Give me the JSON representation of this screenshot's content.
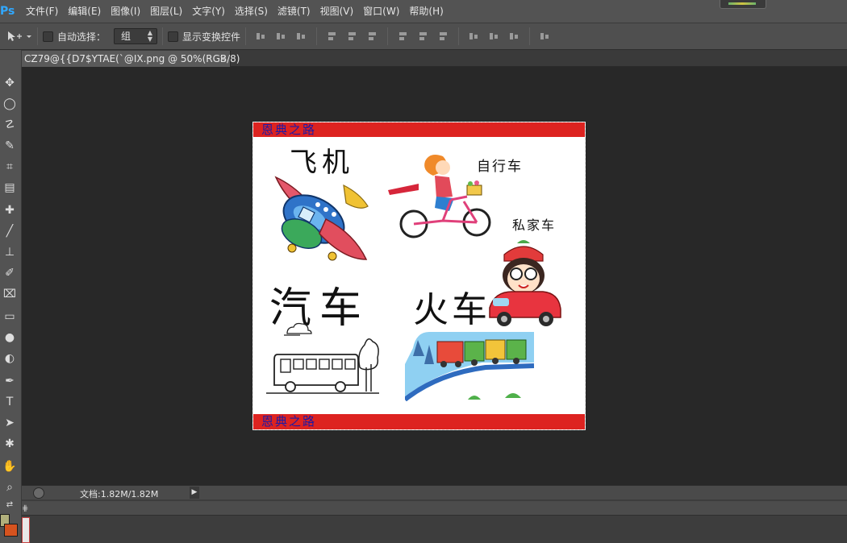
{
  "app": {
    "logo": "Ps"
  },
  "menu": [
    "文件(F)",
    "编辑(E)",
    "图像(I)",
    "图层(L)",
    "文字(Y)",
    "选择(S)",
    "滤镜(T)",
    "视图(V)",
    "窗口(W)",
    "帮助(H)"
  ],
  "options": {
    "auto_select_label": "自动选择：",
    "auto_select_value": "组",
    "show_transform_label": "显示变换控件"
  },
  "document": {
    "tab_title": "CZ79@{{D7$YTAE(`@IX.png @ 50%(RGB/8)",
    "close_glyph": "×",
    "banner_top": "恩典之路",
    "banner_bottom": "恩典之路",
    "words": {
      "plane": "飞机",
      "bicycle": "自行车",
      "private_car": "私家车",
      "automobile": "汽车",
      "train": "火车"
    },
    "train_flag": "school"
  },
  "status": {
    "doc_info": "文档:1.82M/1.82M",
    "arrow": "▶"
  },
  "bottom_panel": {
    "corner_glyph": "⋕"
  },
  "colors": {
    "banner": "#dd2320",
    "banner_text": "#1d1aa6",
    "foreground": "#b1b07c",
    "background": "#d6531f"
  }
}
